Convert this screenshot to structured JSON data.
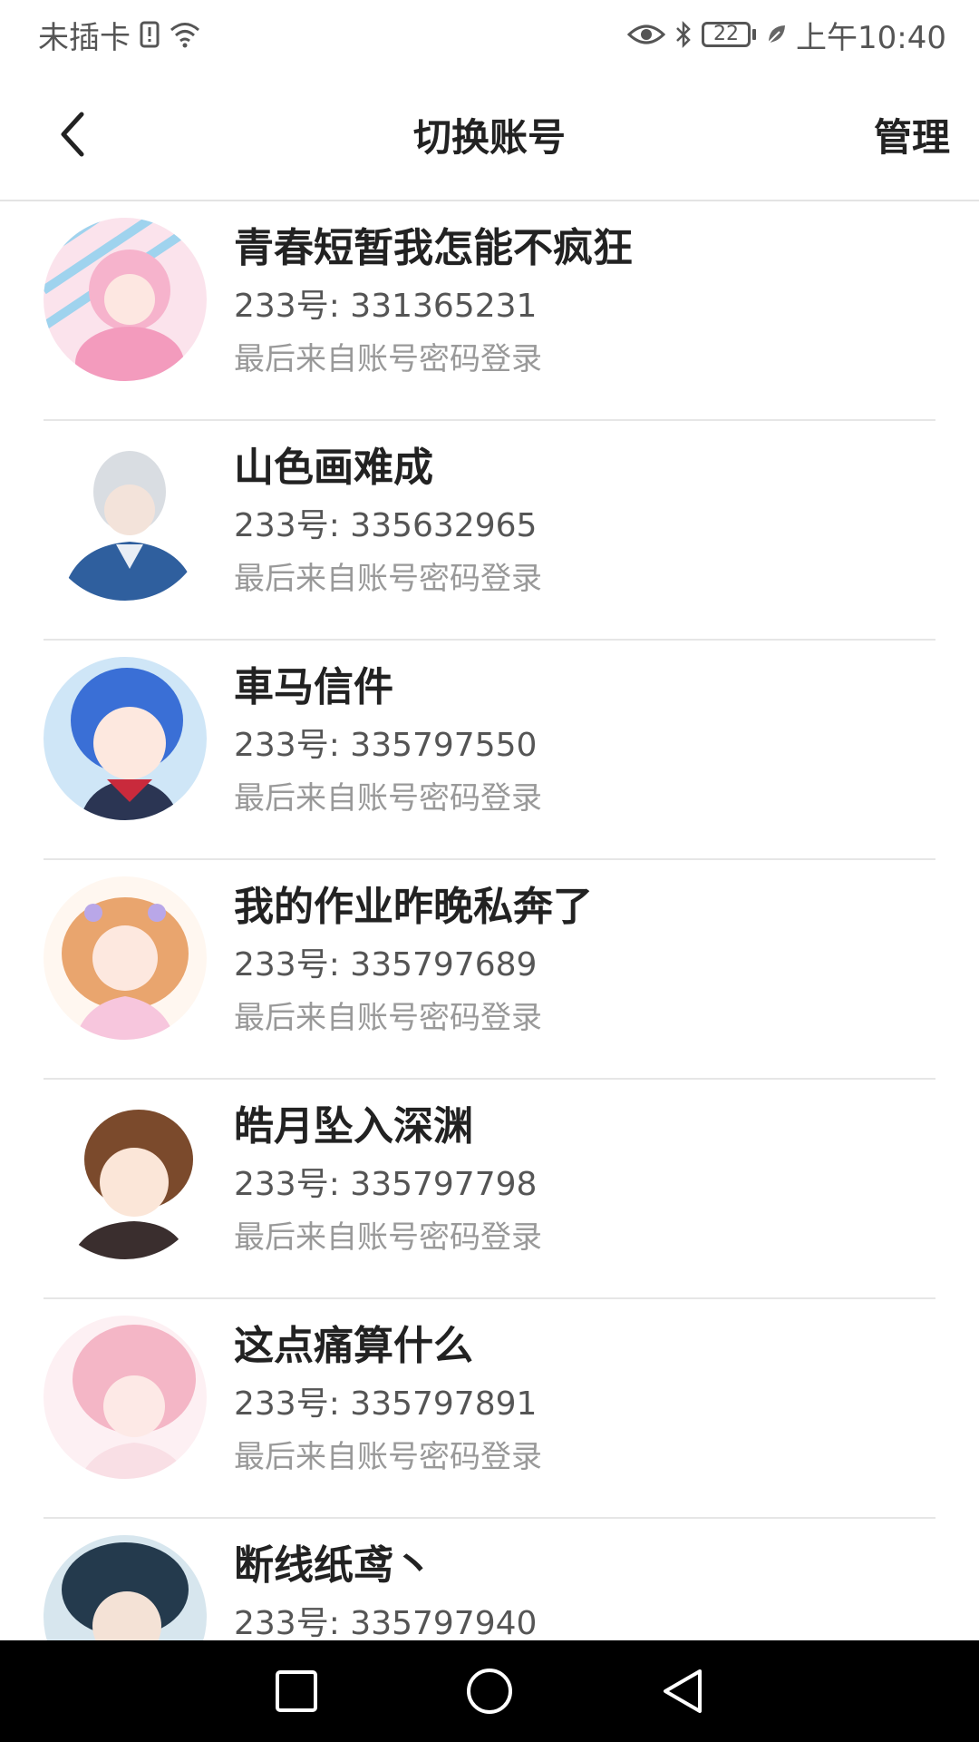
{
  "status_bar": {
    "carrier": "未插卡",
    "battery": "22",
    "time": "上午10:40"
  },
  "header": {
    "title": "切换账号",
    "manage_label": "管理"
  },
  "accounts": [
    {
      "name": "青春短暂我怎能不疯狂",
      "id": "233号: 331365231",
      "last_login": "最后来自账号密码登录"
    },
    {
      "name": "山色画难成",
      "id": "233号: 335632965",
      "last_login": "最后来自账号密码登录"
    },
    {
      "name": "車马信件",
      "id": "233号: 335797550",
      "last_login": "最后来自账号密码登录"
    },
    {
      "name": "我的作业昨晚私奔了",
      "id": "233号: 335797689",
      "last_login": "最后来自账号密码登录"
    },
    {
      "name": "皓月坠入深渊",
      "id": "233号: 335797798",
      "last_login": "最后来自账号密码登录"
    },
    {
      "name": "这点痛算什么",
      "id": "233号: 335797891",
      "last_login": "最后来自账号密码登录"
    },
    {
      "name": "断线纸鸢丶",
      "id": "233号: 335797940",
      "last_login": ""
    }
  ],
  "avatar_colors": [
    "#f4a9c4",
    "#e9eef5",
    "#3f6fd0",
    "#f3c7a8",
    "#8a5a3a",
    "#f6c4d0",
    "#2c4a5a"
  ],
  "nav_icons": [
    "square-icon",
    "circle-icon",
    "triangle-back-icon"
  ]
}
